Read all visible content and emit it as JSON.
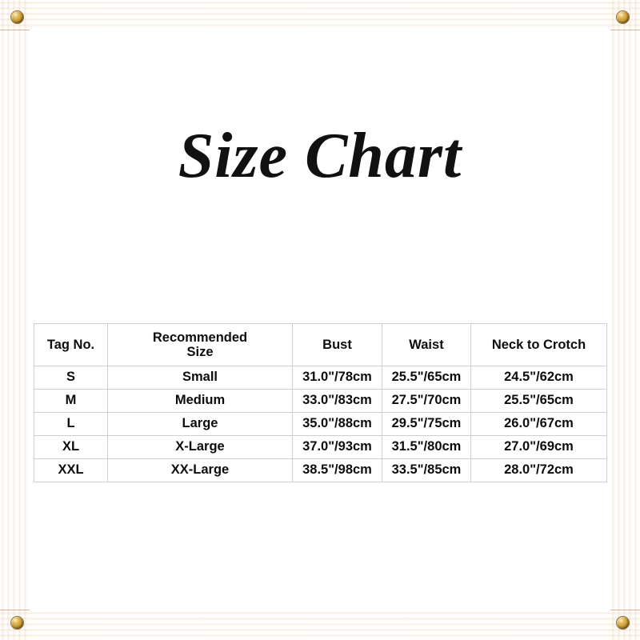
{
  "title": "Size Chart",
  "frame": {
    "material": "wood",
    "wood_color": "#ecd0a0",
    "wood_shadow": "#d8a96e",
    "screw_color": "#c59a33",
    "screws": [
      {
        "name": "screw-top-left"
      },
      {
        "name": "screw-top-right"
      },
      {
        "name": "screw-bottom-left"
      },
      {
        "name": "screw-bottom-right"
      }
    ]
  },
  "table": {
    "border_color": "#cfcfcf",
    "text_color": "#0d0d0d",
    "headers": [
      "Tag No.",
      "Recommended Size",
      "Bust",
      "Waist",
      "Neck to Crotch"
    ],
    "header_recommended_lines": [
      "Recommended",
      "Size"
    ],
    "rows": [
      {
        "tag_no": "S",
        "recommended_size": "Small",
        "bust": "31.0\"/78cm",
        "waist": "25.5\"/65cm",
        "neck_to_crotch": "24.5\"/62cm"
      },
      {
        "tag_no": "M",
        "recommended_size": "Medium",
        "bust": "33.0\"/83cm",
        "waist": "27.5\"/70cm",
        "neck_to_crotch": "25.5\"/65cm"
      },
      {
        "tag_no": "L",
        "recommended_size": "Large",
        "bust": "35.0\"/88cm",
        "waist": "29.5\"/75cm",
        "neck_to_crotch": "26.0\"/67cm"
      },
      {
        "tag_no": "XL",
        "recommended_size": "X-Large",
        "bust": "37.0\"/93cm",
        "waist": "31.5\"/80cm",
        "neck_to_crotch": "27.0\"/69cm"
      },
      {
        "tag_no": "XXL",
        "recommended_size": "XX-Large",
        "bust": "38.5\"/98cm",
        "waist": "33.5\"/85cm",
        "neck_to_crotch": "28.0\"/72cm"
      }
    ]
  }
}
